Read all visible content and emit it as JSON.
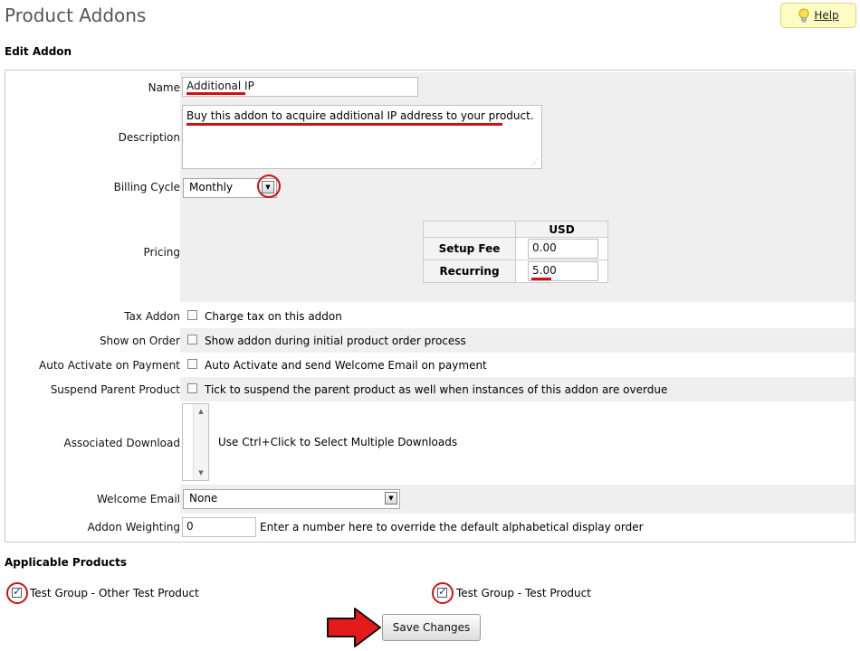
{
  "page": {
    "title": "Product Addons"
  },
  "help": {
    "label": "Help",
    "icon": "lightbulb-icon"
  },
  "edit_section": {
    "title": "Edit Addon"
  },
  "form": {
    "name": {
      "label": "Name",
      "value": "Additional IP"
    },
    "description": {
      "label": "Description",
      "value": "Buy this addon to acquire additional IP address to your product."
    },
    "billing_cycle": {
      "label": "Billing Cycle",
      "selected": "Monthly"
    },
    "pricing": {
      "label": "Pricing",
      "currency": "USD",
      "setup_fee_label": "Setup Fee",
      "setup_fee": "0.00",
      "recurring_label": "Recurring",
      "recurring": "5.00"
    },
    "tax_addon": {
      "label": "Tax Addon",
      "text": "Charge tax on this addon",
      "checked": false
    },
    "show_on_order": {
      "label": "Show on Order",
      "text": "Show addon during initial product order process",
      "checked": false
    },
    "auto_activate": {
      "label": "Auto Activate on Payment",
      "text": "Auto Activate and send Welcome Email on payment",
      "checked": false
    },
    "suspend_parent": {
      "label": "Suspend Parent Product",
      "text": "Tick to suspend the parent product as well when instances of this addon are overdue",
      "checked": false
    },
    "associated_download": {
      "label": "Associated Download",
      "hint": "Use Ctrl+Click to Select Multiple Downloads"
    },
    "welcome_email": {
      "label": "Welcome Email",
      "selected": "None"
    },
    "addon_weighting": {
      "label": "Addon Weighting",
      "value": "0",
      "hint": "Enter a number here to override the default alphabetical display order"
    }
  },
  "applicable_products": {
    "title": "Applicable Products",
    "items": [
      {
        "label": "Test Group - Other Test Product",
        "checked": true
      },
      {
        "label": "Test Group - Test Product",
        "checked": true
      }
    ]
  },
  "save": {
    "label": "Save Changes"
  },
  "colors": {
    "annotation": "#d21010",
    "field_bg": "#efefef",
    "help_bg": "#fdfcc4"
  }
}
